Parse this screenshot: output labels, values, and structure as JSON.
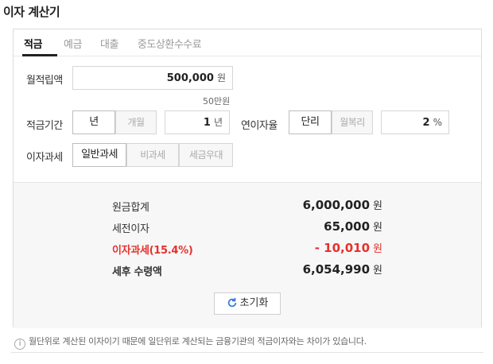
{
  "title": "이자 계산기",
  "tabs": [
    "적금",
    "예금",
    "대출",
    "중도상환수수료"
  ],
  "monthly": {
    "label": "월적립액",
    "value": "500,000",
    "unit": "원",
    "hint": "50만원"
  },
  "period": {
    "label": "적금기간",
    "opt_year": "년",
    "opt_month": "개월",
    "value": "1",
    "unit": "년"
  },
  "rate": {
    "label": "연이자율",
    "opt_simple": "단리",
    "opt_compound": "월복리",
    "value": "2",
    "unit": "%"
  },
  "tax": {
    "label": "이자과세",
    "opt_general": "일반과세",
    "opt_exempt": "비과세",
    "opt_preferential": "세금우대"
  },
  "results": {
    "principal_label": "원금합계",
    "principal_value": "6,000,000",
    "principal_unit": "원",
    "pretax_label": "세전이자",
    "pretax_value": "65,000",
    "pretax_unit": "원",
    "tax_label": "이자과세(15.4%)",
    "tax_value": "- 10,010",
    "tax_unit": "원",
    "net_label": "세후 수령액",
    "net_value": "6,054,990",
    "net_unit": "원"
  },
  "reset_label": "초기화",
  "note": "월단위로 계산된 이자이기 때문에 일단위로 계산되는 금융기관의 적금이자와는 차이가 있습니다.",
  "colors": {
    "accent_red": "#e5322d",
    "border": "#dcdcdc",
    "result_bg": "#f7f7f7"
  },
  "icons": {
    "reset": "refresh-icon",
    "info": "info-icon"
  }
}
